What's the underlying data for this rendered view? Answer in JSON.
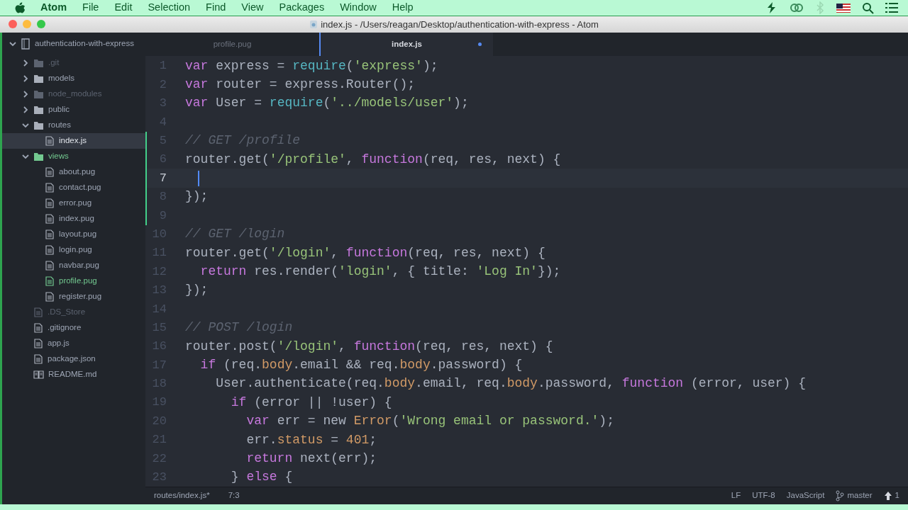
{
  "menu_bar": {
    "app": "Atom",
    "items": [
      "File",
      "Edit",
      "Selection",
      "Find",
      "View",
      "Packages",
      "Window",
      "Help"
    ]
  },
  "window": {
    "title": "index.js - /Users/reagan/Desktop/authentication-with-express - Atom"
  },
  "tree": {
    "project": "authentication-with-express",
    "items": [
      {
        "name": ".git",
        "kind": "folder",
        "expanded": false,
        "ignored": true,
        "modified": false,
        "selected": false
      },
      {
        "name": "models",
        "kind": "folder",
        "expanded": false,
        "ignored": false,
        "modified": false,
        "selected": false
      },
      {
        "name": "node_modules",
        "kind": "folder",
        "expanded": false,
        "ignored": true,
        "modified": false,
        "selected": false
      },
      {
        "name": "public",
        "kind": "folder",
        "expanded": false,
        "ignored": false,
        "modified": false,
        "selected": false
      },
      {
        "name": "routes",
        "kind": "folder",
        "expanded": true,
        "ignored": false,
        "modified": false,
        "selected": false,
        "children": [
          {
            "name": "index.js",
            "kind": "file",
            "ignored": false,
            "modified": false,
            "selected": true
          }
        ]
      },
      {
        "name": "views",
        "kind": "folder",
        "expanded": true,
        "ignored": false,
        "modified": true,
        "selected": false,
        "children": [
          {
            "name": "about.pug",
            "kind": "file",
            "ignored": false,
            "modified": false,
            "selected": false
          },
          {
            "name": "contact.pug",
            "kind": "file",
            "ignored": false,
            "modified": false,
            "selected": false
          },
          {
            "name": "error.pug",
            "kind": "file",
            "ignored": false,
            "modified": false,
            "selected": false
          },
          {
            "name": "index.pug",
            "kind": "file",
            "ignored": false,
            "modified": false,
            "selected": false
          },
          {
            "name": "layout.pug",
            "kind": "file",
            "ignored": false,
            "modified": false,
            "selected": false
          },
          {
            "name": "login.pug",
            "kind": "file",
            "ignored": false,
            "modified": false,
            "selected": false
          },
          {
            "name": "navbar.pug",
            "kind": "file",
            "ignored": false,
            "modified": false,
            "selected": false
          },
          {
            "name": "profile.pug",
            "kind": "file",
            "ignored": false,
            "modified": true,
            "selected": false
          },
          {
            "name": "register.pug",
            "kind": "file",
            "ignored": false,
            "modified": false,
            "selected": false
          }
        ]
      },
      {
        "name": ".DS_Store",
        "kind": "file",
        "ignored": true,
        "modified": false,
        "selected": false
      },
      {
        "name": ".gitignore",
        "kind": "file",
        "ignored": false,
        "modified": false,
        "selected": false
      },
      {
        "name": "app.js",
        "kind": "file",
        "ignored": false,
        "modified": false,
        "selected": false
      },
      {
        "name": "package.json",
        "kind": "file",
        "ignored": false,
        "modified": false,
        "selected": false
      },
      {
        "name": "README.md",
        "kind": "readme",
        "ignored": false,
        "modified": false,
        "selected": false
      }
    ]
  },
  "tabs": [
    {
      "label": "profile.pug",
      "selected": false,
      "modified": false
    },
    {
      "label": "index.js",
      "selected": true,
      "modified": true
    }
  ],
  "editor": {
    "lines": [
      {
        "number": "1",
        "changed": false,
        "current": false,
        "tokens": [
          {
            "kind": "keyword",
            "text": "var"
          },
          {
            "kind": "plain",
            "text": " express = "
          },
          {
            "kind": "function",
            "text": "require"
          },
          {
            "kind": "plain",
            "text": "("
          },
          {
            "kind": "string",
            "text": "'express'"
          },
          {
            "kind": "plain",
            "text": ");"
          }
        ]
      },
      {
        "number": "2",
        "changed": false,
        "current": false,
        "tokens": [
          {
            "kind": "keyword",
            "text": "var"
          },
          {
            "kind": "plain",
            "text": " router = express.Router();"
          }
        ]
      },
      {
        "number": "3",
        "changed": false,
        "current": false,
        "tokens": [
          {
            "kind": "keyword",
            "text": "var"
          },
          {
            "kind": "plain",
            "text": " User = "
          },
          {
            "kind": "function",
            "text": "require"
          },
          {
            "kind": "plain",
            "text": "("
          },
          {
            "kind": "string",
            "text": "'../models/user'"
          },
          {
            "kind": "plain",
            "text": ");"
          }
        ]
      },
      {
        "number": "4",
        "changed": false,
        "current": false
      },
      {
        "number": "5",
        "changed": true,
        "current": false,
        "tokens": [
          {
            "kind": "comment",
            "text": "// GET /profile"
          }
        ]
      },
      {
        "number": "6",
        "changed": true,
        "current": false,
        "tokens": [
          {
            "kind": "plain",
            "text": "router.get("
          },
          {
            "kind": "string",
            "text": "'/profile'"
          },
          {
            "kind": "plain",
            "text": ", "
          },
          {
            "kind": "keyword",
            "text": "function"
          },
          {
            "kind": "plain",
            "text": "(req, res, next) {"
          }
        ]
      },
      {
        "number": "7",
        "changed": true,
        "current": true
      },
      {
        "number": "8",
        "changed": true,
        "current": false,
        "tokens": [
          {
            "kind": "plain",
            "text": "});"
          }
        ]
      },
      {
        "number": "9",
        "changed": true,
        "current": false
      },
      {
        "number": "10",
        "changed": false,
        "current": false,
        "tokens": [
          {
            "kind": "comment",
            "text": "// GET /login"
          }
        ]
      },
      {
        "number": "11",
        "changed": false,
        "current": false,
        "tokens": [
          {
            "kind": "plain",
            "text": "router.get("
          },
          {
            "kind": "string",
            "text": "'/login'"
          },
          {
            "kind": "plain",
            "text": ", "
          },
          {
            "kind": "keyword",
            "text": "function"
          },
          {
            "kind": "plain",
            "text": "(req, res, next) {"
          }
        ]
      },
      {
        "number": "12",
        "changed": false,
        "current": false,
        "tokens": [
          {
            "kind": "keyword",
            "text": "  return"
          },
          {
            "kind": "plain",
            "text": " res.render("
          },
          {
            "kind": "string",
            "text": "'login'"
          },
          {
            "kind": "plain",
            "text": ", { title: "
          },
          {
            "kind": "string",
            "text": "'Log In'"
          },
          {
            "kind": "plain",
            "text": "});"
          }
        ]
      },
      {
        "number": "13",
        "changed": false,
        "current": false,
        "tokens": [
          {
            "kind": "plain",
            "text": "});"
          }
        ]
      },
      {
        "number": "14",
        "changed": false,
        "current": false
      },
      {
        "number": "15",
        "changed": false,
        "current": false,
        "tokens": [
          {
            "kind": "comment",
            "text": "// POST /login"
          }
        ]
      },
      {
        "number": "16",
        "changed": false,
        "current": false,
        "tokens": [
          {
            "kind": "plain",
            "text": "router.post("
          },
          {
            "kind": "string",
            "text": "'/login'"
          },
          {
            "kind": "plain",
            "text": ", "
          },
          {
            "kind": "keyword",
            "text": "function"
          },
          {
            "kind": "plain",
            "text": "(req, res, next) {"
          }
        ]
      },
      {
        "number": "17",
        "changed": false,
        "current": false,
        "tokens": [
          {
            "kind": "keyword",
            "text": "  if"
          },
          {
            "kind": "plain",
            "text": " (req."
          },
          {
            "kind": "property",
            "text": "body"
          },
          {
            "kind": "plain",
            "text": ".email && req."
          },
          {
            "kind": "property",
            "text": "body"
          },
          {
            "kind": "plain",
            "text": ".password) {"
          }
        ]
      },
      {
        "number": "18",
        "changed": false,
        "current": false,
        "tokens": [
          {
            "kind": "plain",
            "text": "    User.authenticate(req."
          },
          {
            "kind": "property",
            "text": "body"
          },
          {
            "kind": "plain",
            "text": ".email, req."
          },
          {
            "kind": "property",
            "text": "body"
          },
          {
            "kind": "plain",
            "text": ".password, "
          },
          {
            "kind": "keyword",
            "text": "function"
          },
          {
            "kind": "plain",
            "text": " (error, user) {"
          }
        ]
      },
      {
        "number": "19",
        "changed": false,
        "current": false,
        "tokens": [
          {
            "kind": "keyword",
            "text": "      if"
          },
          {
            "kind": "plain",
            "text": " (error || !user) {"
          }
        ]
      },
      {
        "number": "20",
        "changed": false,
        "current": false,
        "tokens": [
          {
            "kind": "keyword",
            "text": "        var"
          },
          {
            "kind": "plain",
            "text": " err = new "
          },
          {
            "kind": "property",
            "text": "Error"
          },
          {
            "kind": "plain",
            "text": "("
          },
          {
            "kind": "string",
            "text": "'Wrong email or password.'"
          },
          {
            "kind": "plain",
            "text": ");"
          }
        ]
      },
      {
        "number": "21",
        "changed": false,
        "current": false,
        "tokens": [
          {
            "kind": "plain",
            "text": "        err."
          },
          {
            "kind": "property",
            "text": "status"
          },
          {
            "kind": "plain",
            "text": " = "
          },
          {
            "kind": "number",
            "text": "401"
          },
          {
            "kind": "plain",
            "text": ";"
          }
        ]
      },
      {
        "number": "22",
        "changed": false,
        "current": false,
        "tokens": [
          {
            "kind": "keyword",
            "text": "        return"
          },
          {
            "kind": "plain",
            "text": " next(err);"
          }
        ]
      },
      {
        "number": "23",
        "changed": false,
        "current": false,
        "tokens": [
          {
            "kind": "plain",
            "text": "      } "
          },
          {
            "kind": "keyword",
            "text": "else"
          },
          {
            "kind": "plain",
            "text": " {"
          }
        ]
      }
    ]
  },
  "status_bar": {
    "file": "routes/index.js*",
    "position": "7:3",
    "line_ending": "LF",
    "encoding": "UTF-8",
    "grammar": "JavaScript",
    "branch": "master",
    "ahead": "1"
  }
}
